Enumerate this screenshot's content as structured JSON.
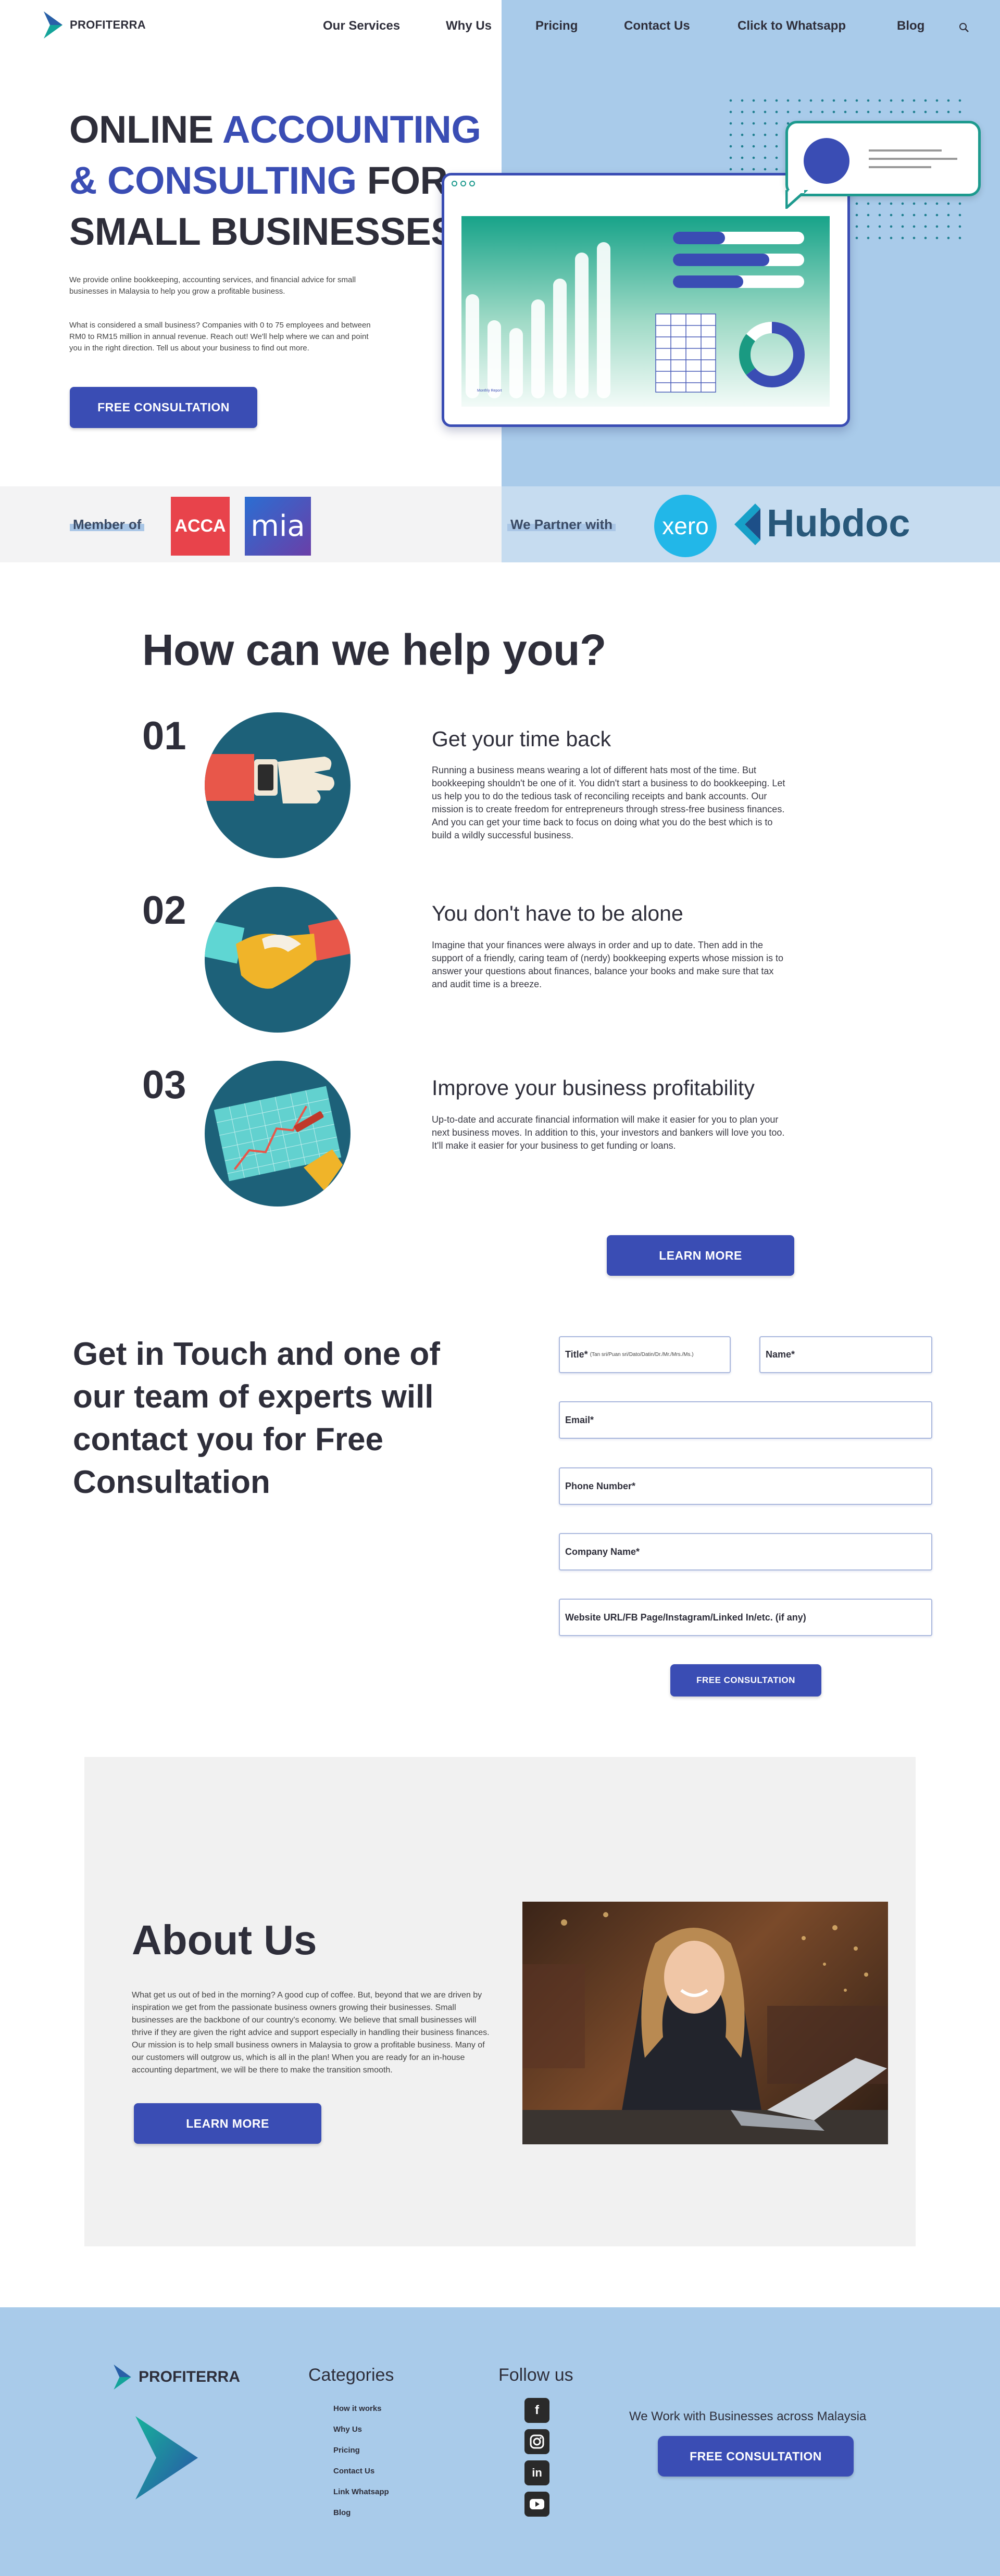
{
  "brand": {
    "name": "PROFITERRA"
  },
  "nav": {
    "items": [
      "Our Services",
      "Why Us",
      "Pricing",
      "Contact Us",
      "Click to Whatsapp",
      "Blog"
    ],
    "search_icon": "search-icon"
  },
  "hero": {
    "title_line1_a": "ONLINE ",
    "title_line1_b": "ACCOUNTING",
    "title_line2_a": "& CONSULTING",
    "title_line2_b": " FOR",
    "title_line3": "SMALL BUSINESSES",
    "para1": "We provide online bookkeeping, accounting services, and financial advice for small businesses in Malaysia to help you grow a profitable business.",
    "para2": "What is considered a small business? Companies with 0 to 75 employees and between RM0 to RM15 million in annual revenue. Reach out! We'll help where we can and point you in the right direction. Tell us about your business to find out more.",
    "cta": "FREE CONSULTATION",
    "mini_chart_label": "Monthly Report"
  },
  "strip": {
    "member_label": "Member of",
    "acca": "ACCA",
    "mia": "mia",
    "partner_label": "We Partner with",
    "xero": "xero",
    "hubdoc": "Hubdoc"
  },
  "help": {
    "title": "How can we help you?",
    "items": [
      {
        "num": "01",
        "heading": "Get your time back",
        "text": "Running a business means wearing a lot of different hats most of the time. But bookkeeping shouldn't be one of it. You didn't start a business to do bookkeeping. Let us help you to do the tedious task of reconciling receipts and bank accounts. Our mission is to create freedom for entrepreneurs through stress-free business finances. And you can get your time back to focus on doing what you do the best which is to build a wildly successful business."
      },
      {
        "num": "02",
        "heading": "You don't have to be alone",
        "text": "Imagine that your finances were always in order and up to date. Then add in the support of a friendly, caring team of (nerdy) bookkeeping experts whose mission is to answer your questions about finances, balance your books and make sure that tax and audit time is a breeze."
      },
      {
        "num": "03",
        "heading": "Improve your business profitability",
        "text": "Up-to-date and accurate financial information will make it easier for you to plan your next business moves. In addition to this, your investors and bankers will love you too. It'll make it easier for your business to get funding or loans."
      }
    ],
    "cta": "LEARN MORE"
  },
  "contact": {
    "heading": "Get in Touch and one of our team of experts will contact you for Free Consultation",
    "fields": {
      "title": "Title*",
      "title_hint": "(Tan sri/Puan sri/Dato/Datin/Dr./Mr./Mrs./Ms.)",
      "name": "Name*",
      "email": "Email*",
      "phone": "Phone Number*",
      "company": "Company Name*",
      "website": "Website URL/FB Page/Instagram/Linked In/etc. (if any)"
    },
    "submit": "FREE CONSULTATION"
  },
  "about": {
    "title": "About Us",
    "text": "What get us out of bed in the morning? A good cup of coffee. But, beyond that we are driven by inspiration we get from the passionate business owners growing their businesses. Small businesses are the backbone of our country's economy. We believe that small businesses will thrive if they are given the right advice and support especially in handling their business finances. Our mission is to help small business owners in Malaysia to grow a profitable business. Many of our customers will outgrow us, which is all in the plan! When you are ready for an in-house accounting department, we will be there to make the transition smooth.",
    "cta": "LEARN MORE"
  },
  "footer": {
    "brand": "PROFITERRA",
    "categories_title": "Categories",
    "categories": [
      "How it works",
      "Why Us",
      "Pricing",
      "Contact Us",
      "Link Whatsapp",
      "Blog"
    ],
    "follow_title": "Follow us",
    "social": [
      "facebook-icon",
      "instagram-icon",
      "linkedin-icon",
      "youtube-icon"
    ],
    "tagline": "We Work with Businesses across Malaysia",
    "cta": "FREE CONSULTATION"
  },
  "colors": {
    "primary": "#3a4db4",
    "panel": "#a9cbea",
    "teal": "#1d6179",
    "dark": "#2e2e3a"
  }
}
